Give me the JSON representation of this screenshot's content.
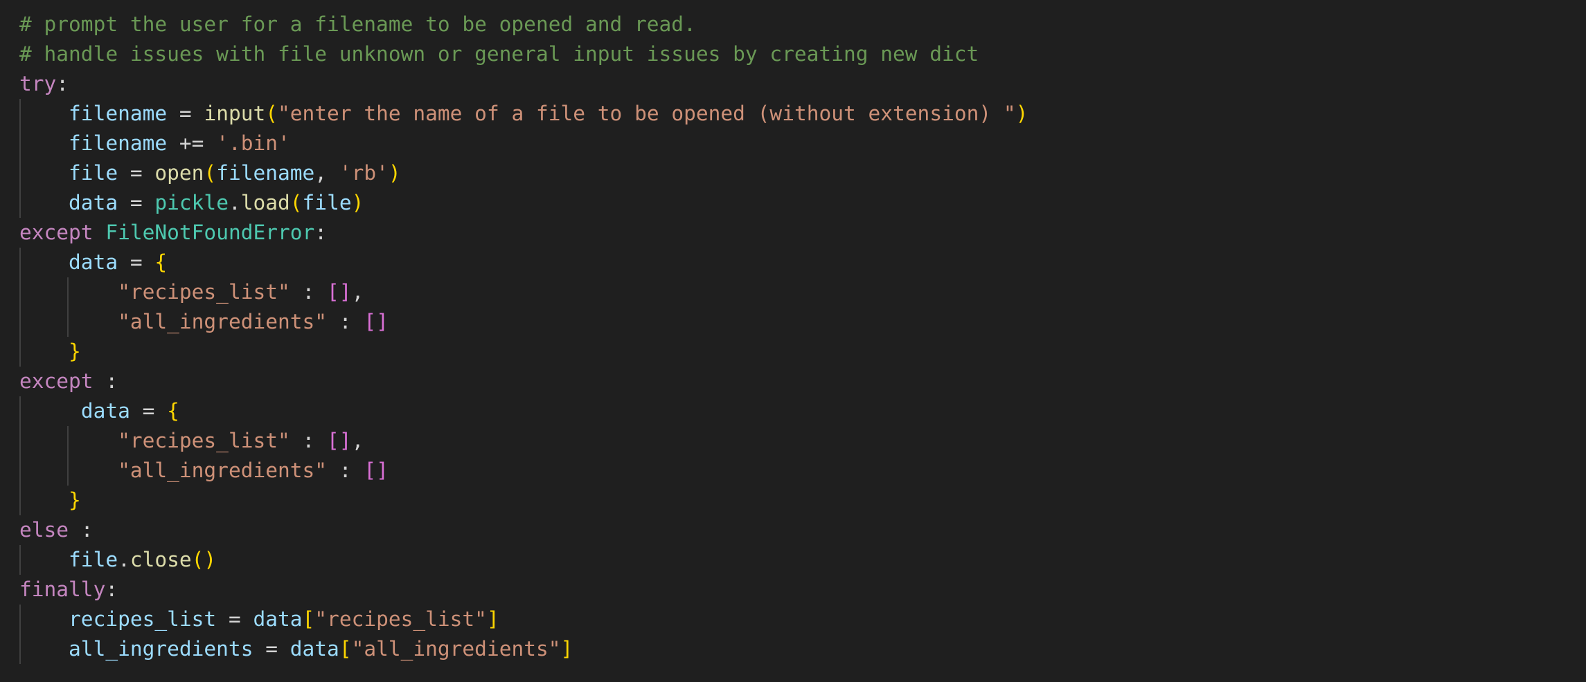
{
  "editor": {
    "theme": {
      "background": "#1f1f1f",
      "comment": "#6a9955",
      "keyword": "#c586c0",
      "variable": "#9cdcfe",
      "operator": "#d4d4d4",
      "function": "#dcdcaa",
      "string": "#ce9178",
      "class": "#4ec9b0",
      "bracket_level1": "#ffd700",
      "bracket_level2": "#da70d6",
      "indent_guide": "#404040"
    },
    "lines": [
      {
        "guides": 0,
        "tokens": [
          {
            "t": "comment",
            "v": "# prompt the user for a filename to be opened and read."
          }
        ]
      },
      {
        "guides": 0,
        "tokens": [
          {
            "t": "comment",
            "v": "# handle issues with file unknown or general input issues by creating new dict"
          }
        ]
      },
      {
        "guides": 0,
        "tokens": [
          {
            "t": "kw",
            "v": "try"
          },
          {
            "t": "op",
            "v": ":"
          }
        ]
      },
      {
        "guides": 1,
        "tokens": [
          {
            "t": "op",
            "v": "    "
          },
          {
            "t": "var",
            "v": "filename"
          },
          {
            "t": "op",
            "v": " = "
          },
          {
            "t": "fn",
            "v": "input"
          },
          {
            "t": "br1",
            "v": "("
          },
          {
            "t": "str",
            "v": "\"enter the name of a file to be opened (without extension) \""
          },
          {
            "t": "br1",
            "v": ")"
          }
        ]
      },
      {
        "guides": 1,
        "tokens": [
          {
            "t": "op",
            "v": "    "
          },
          {
            "t": "var",
            "v": "filename"
          },
          {
            "t": "op",
            "v": " += "
          },
          {
            "t": "str",
            "v": "'.bin'"
          }
        ]
      },
      {
        "guides": 1,
        "tokens": [
          {
            "t": "op",
            "v": "    "
          },
          {
            "t": "var",
            "v": "file"
          },
          {
            "t": "op",
            "v": " = "
          },
          {
            "t": "fn",
            "v": "open"
          },
          {
            "t": "br1",
            "v": "("
          },
          {
            "t": "var",
            "v": "filename"
          },
          {
            "t": "op",
            "v": ", "
          },
          {
            "t": "str",
            "v": "'rb'"
          },
          {
            "t": "br1",
            "v": ")"
          }
        ]
      },
      {
        "guides": 1,
        "tokens": [
          {
            "t": "op",
            "v": "    "
          },
          {
            "t": "var",
            "v": "data"
          },
          {
            "t": "op",
            "v": " = "
          },
          {
            "t": "cls",
            "v": "pickle"
          },
          {
            "t": "op",
            "v": "."
          },
          {
            "t": "fn",
            "v": "load"
          },
          {
            "t": "br1",
            "v": "("
          },
          {
            "t": "var",
            "v": "file"
          },
          {
            "t": "br1",
            "v": ")"
          }
        ]
      },
      {
        "guides": 0,
        "tokens": [
          {
            "t": "kw",
            "v": "except"
          },
          {
            "t": "op",
            "v": " "
          },
          {
            "t": "cls",
            "v": "FileNotFoundError"
          },
          {
            "t": "op",
            "v": ":"
          }
        ]
      },
      {
        "guides": 1,
        "tokens": [
          {
            "t": "op",
            "v": "    "
          },
          {
            "t": "var",
            "v": "data"
          },
          {
            "t": "op",
            "v": " = "
          },
          {
            "t": "br1",
            "v": "{"
          }
        ]
      },
      {
        "guides": 2,
        "tokens": [
          {
            "t": "op",
            "v": "        "
          },
          {
            "t": "str",
            "v": "\"recipes_list\""
          },
          {
            "t": "op",
            "v": " : "
          },
          {
            "t": "br2",
            "v": "[]"
          },
          {
            "t": "op",
            "v": ","
          }
        ]
      },
      {
        "guides": 2,
        "tokens": [
          {
            "t": "op",
            "v": "        "
          },
          {
            "t": "str",
            "v": "\"all_ingredients\""
          },
          {
            "t": "op",
            "v": " : "
          },
          {
            "t": "br2",
            "v": "[]"
          }
        ]
      },
      {
        "guides": 1,
        "tokens": [
          {
            "t": "op",
            "v": "    "
          },
          {
            "t": "br1",
            "v": "}"
          }
        ]
      },
      {
        "guides": 0,
        "tokens": [
          {
            "t": "kw",
            "v": "except"
          },
          {
            "t": "op",
            "v": " :"
          }
        ]
      },
      {
        "guides": 1,
        "tokens": [
          {
            "t": "op",
            "v": "     "
          },
          {
            "t": "var",
            "v": "data"
          },
          {
            "t": "op",
            "v": " = "
          },
          {
            "t": "br1",
            "v": "{"
          }
        ]
      },
      {
        "guides": 2,
        "tokens": [
          {
            "t": "op",
            "v": "        "
          },
          {
            "t": "str",
            "v": "\"recipes_list\""
          },
          {
            "t": "op",
            "v": " : "
          },
          {
            "t": "br2",
            "v": "[]"
          },
          {
            "t": "op",
            "v": ","
          }
        ]
      },
      {
        "guides": 2,
        "tokens": [
          {
            "t": "op",
            "v": "        "
          },
          {
            "t": "str",
            "v": "\"all_ingredients\""
          },
          {
            "t": "op",
            "v": " : "
          },
          {
            "t": "br2",
            "v": "[]"
          }
        ]
      },
      {
        "guides": 1,
        "tokens": [
          {
            "t": "op",
            "v": "    "
          },
          {
            "t": "br1",
            "v": "}"
          }
        ]
      },
      {
        "guides": 0,
        "tokens": [
          {
            "t": "kw",
            "v": "else"
          },
          {
            "t": "op",
            "v": " :"
          }
        ]
      },
      {
        "guides": 1,
        "tokens": [
          {
            "t": "op",
            "v": "    "
          },
          {
            "t": "var",
            "v": "file"
          },
          {
            "t": "op",
            "v": "."
          },
          {
            "t": "fn",
            "v": "close"
          },
          {
            "t": "br1",
            "v": "()"
          }
        ]
      },
      {
        "guides": 0,
        "tokens": [
          {
            "t": "kw",
            "v": "finally"
          },
          {
            "t": "op",
            "v": ":"
          }
        ]
      },
      {
        "guides": 1,
        "tokens": [
          {
            "t": "op",
            "v": "    "
          },
          {
            "t": "var",
            "v": "recipes_list"
          },
          {
            "t": "op",
            "v": " = "
          },
          {
            "t": "var",
            "v": "data"
          },
          {
            "t": "br1",
            "v": "["
          },
          {
            "t": "str",
            "v": "\"recipes_list\""
          },
          {
            "t": "br1",
            "v": "]"
          }
        ]
      },
      {
        "guides": 1,
        "tokens": [
          {
            "t": "op",
            "v": "    "
          },
          {
            "t": "var",
            "v": "all_ingredients"
          },
          {
            "t": "op",
            "v": " = "
          },
          {
            "t": "var",
            "v": "data"
          },
          {
            "t": "br1",
            "v": "["
          },
          {
            "t": "str",
            "v": "\"all_ingredients\""
          },
          {
            "t": "br1",
            "v": "]"
          }
        ]
      }
    ]
  }
}
